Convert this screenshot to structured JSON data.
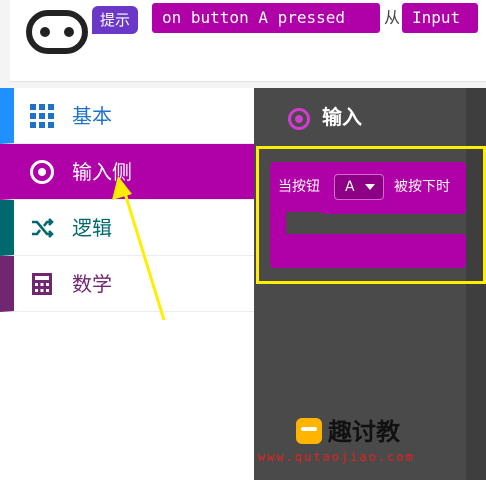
{
  "hint": {
    "badge": "提示",
    "event_block": "on button A pressed",
    "from_text": "从",
    "input_block": "Input"
  },
  "categories": [
    {
      "label": "基本",
      "color": "#1e72c8"
    },
    {
      "label": "输入侧",
      "color": "#b000a8"
    },
    {
      "label": "逻辑",
      "color": "#006970"
    },
    {
      "label": "数学",
      "color": "#712672"
    }
  ],
  "flyout": {
    "title": "输入",
    "block": {
      "prefix": "当按钮",
      "button_value": "A",
      "suffix": "被按下时"
    }
  },
  "watermark": {
    "title": "趣讨教",
    "url": "www.qutaojiao.com"
  },
  "colors": {
    "input_accent": "#b000a8",
    "hint_badge": "#6b37c7",
    "highlight": "#ffee00",
    "arrow": "#ffee00"
  }
}
